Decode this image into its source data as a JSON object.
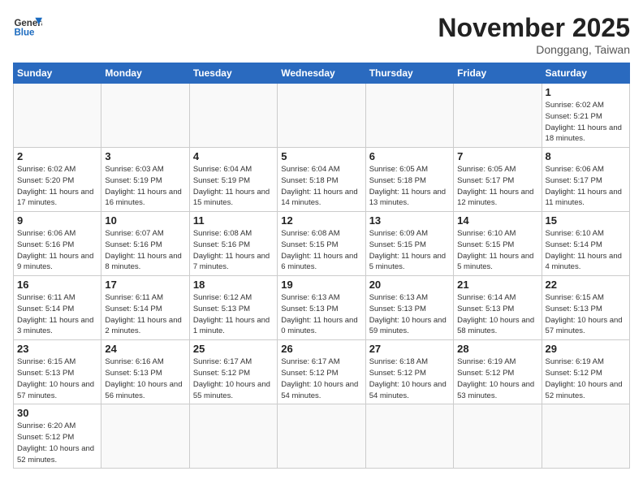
{
  "header": {
    "logo_general": "General",
    "logo_blue": "Blue",
    "title": "November 2025",
    "subtitle": "Donggang, Taiwan"
  },
  "days_of_week": [
    "Sunday",
    "Monday",
    "Tuesday",
    "Wednesday",
    "Thursday",
    "Friday",
    "Saturday"
  ],
  "weeks": [
    [
      {
        "day": "",
        "info": ""
      },
      {
        "day": "",
        "info": ""
      },
      {
        "day": "",
        "info": ""
      },
      {
        "day": "",
        "info": ""
      },
      {
        "day": "",
        "info": ""
      },
      {
        "day": "",
        "info": ""
      },
      {
        "day": "1",
        "info": "Sunrise: 6:02 AM\nSunset: 5:21 PM\nDaylight: 11 hours and 18 minutes."
      }
    ],
    [
      {
        "day": "2",
        "info": "Sunrise: 6:02 AM\nSunset: 5:20 PM\nDaylight: 11 hours and 17 minutes."
      },
      {
        "day": "3",
        "info": "Sunrise: 6:03 AM\nSunset: 5:19 PM\nDaylight: 11 hours and 16 minutes."
      },
      {
        "day": "4",
        "info": "Sunrise: 6:04 AM\nSunset: 5:19 PM\nDaylight: 11 hours and 15 minutes."
      },
      {
        "day": "5",
        "info": "Sunrise: 6:04 AM\nSunset: 5:18 PM\nDaylight: 11 hours and 14 minutes."
      },
      {
        "day": "6",
        "info": "Sunrise: 6:05 AM\nSunset: 5:18 PM\nDaylight: 11 hours and 13 minutes."
      },
      {
        "day": "7",
        "info": "Sunrise: 6:05 AM\nSunset: 5:17 PM\nDaylight: 11 hours and 12 minutes."
      },
      {
        "day": "8",
        "info": "Sunrise: 6:06 AM\nSunset: 5:17 PM\nDaylight: 11 hours and 11 minutes."
      }
    ],
    [
      {
        "day": "9",
        "info": "Sunrise: 6:06 AM\nSunset: 5:16 PM\nDaylight: 11 hours and 9 minutes."
      },
      {
        "day": "10",
        "info": "Sunrise: 6:07 AM\nSunset: 5:16 PM\nDaylight: 11 hours and 8 minutes."
      },
      {
        "day": "11",
        "info": "Sunrise: 6:08 AM\nSunset: 5:16 PM\nDaylight: 11 hours and 7 minutes."
      },
      {
        "day": "12",
        "info": "Sunrise: 6:08 AM\nSunset: 5:15 PM\nDaylight: 11 hours and 6 minutes."
      },
      {
        "day": "13",
        "info": "Sunrise: 6:09 AM\nSunset: 5:15 PM\nDaylight: 11 hours and 5 minutes."
      },
      {
        "day": "14",
        "info": "Sunrise: 6:10 AM\nSunset: 5:15 PM\nDaylight: 11 hours and 5 minutes."
      },
      {
        "day": "15",
        "info": "Sunrise: 6:10 AM\nSunset: 5:14 PM\nDaylight: 11 hours and 4 minutes."
      }
    ],
    [
      {
        "day": "16",
        "info": "Sunrise: 6:11 AM\nSunset: 5:14 PM\nDaylight: 11 hours and 3 minutes."
      },
      {
        "day": "17",
        "info": "Sunrise: 6:11 AM\nSunset: 5:14 PM\nDaylight: 11 hours and 2 minutes."
      },
      {
        "day": "18",
        "info": "Sunrise: 6:12 AM\nSunset: 5:13 PM\nDaylight: 11 hours and 1 minute."
      },
      {
        "day": "19",
        "info": "Sunrise: 6:13 AM\nSunset: 5:13 PM\nDaylight: 11 hours and 0 minutes."
      },
      {
        "day": "20",
        "info": "Sunrise: 6:13 AM\nSunset: 5:13 PM\nDaylight: 10 hours and 59 minutes."
      },
      {
        "day": "21",
        "info": "Sunrise: 6:14 AM\nSunset: 5:13 PM\nDaylight: 10 hours and 58 minutes."
      },
      {
        "day": "22",
        "info": "Sunrise: 6:15 AM\nSunset: 5:13 PM\nDaylight: 10 hours and 57 minutes."
      }
    ],
    [
      {
        "day": "23",
        "info": "Sunrise: 6:15 AM\nSunset: 5:13 PM\nDaylight: 10 hours and 57 minutes."
      },
      {
        "day": "24",
        "info": "Sunrise: 6:16 AM\nSunset: 5:13 PM\nDaylight: 10 hours and 56 minutes."
      },
      {
        "day": "25",
        "info": "Sunrise: 6:17 AM\nSunset: 5:12 PM\nDaylight: 10 hours and 55 minutes."
      },
      {
        "day": "26",
        "info": "Sunrise: 6:17 AM\nSunset: 5:12 PM\nDaylight: 10 hours and 54 minutes."
      },
      {
        "day": "27",
        "info": "Sunrise: 6:18 AM\nSunset: 5:12 PM\nDaylight: 10 hours and 54 minutes."
      },
      {
        "day": "28",
        "info": "Sunrise: 6:19 AM\nSunset: 5:12 PM\nDaylight: 10 hours and 53 minutes."
      },
      {
        "day": "29",
        "info": "Sunrise: 6:19 AM\nSunset: 5:12 PM\nDaylight: 10 hours and 52 minutes."
      }
    ],
    [
      {
        "day": "30",
        "info": "Sunrise: 6:20 AM\nSunset: 5:12 PM\nDaylight: 10 hours and 52 minutes."
      },
      {
        "day": "",
        "info": ""
      },
      {
        "day": "",
        "info": ""
      },
      {
        "day": "",
        "info": ""
      },
      {
        "day": "",
        "info": ""
      },
      {
        "day": "",
        "info": ""
      },
      {
        "day": "",
        "info": ""
      }
    ]
  ]
}
